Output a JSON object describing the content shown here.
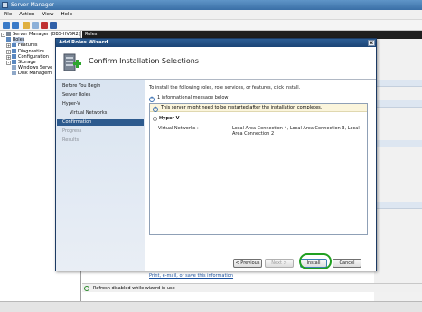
{
  "server_manager": {
    "title": "Server Manager",
    "menu": [
      "File",
      "Action",
      "View",
      "Help"
    ],
    "tree": [
      {
        "label": "Server Manager (OBS-HV5R2)",
        "indent": 0,
        "selected": false,
        "expander": "-"
      },
      {
        "label": "Roles",
        "indent": 1,
        "selected": true,
        "expander": ""
      },
      {
        "label": "Features",
        "indent": 1,
        "selected": false,
        "expander": "+"
      },
      {
        "label": "Diagnostics",
        "indent": 1,
        "selected": false,
        "expander": "+"
      },
      {
        "label": "Configuration",
        "indent": 1,
        "selected": false,
        "expander": "+"
      },
      {
        "label": "Storage",
        "indent": 1,
        "selected": false,
        "expander": "-"
      },
      {
        "label": "Windows Serve",
        "indent": 2,
        "selected": false,
        "expander": ""
      },
      {
        "label": "Disk Managem",
        "indent": 2,
        "selected": false,
        "expander": ""
      }
    ],
    "content_header": "Roles",
    "status_text": "Refresh disabled while wizard in use"
  },
  "wizard": {
    "title": "Add Roles Wizard",
    "close_glyph": "x",
    "heading": "Confirm Installation Selections",
    "steps": [
      {
        "label": "Before You Begin",
        "state": "done",
        "sub": false
      },
      {
        "label": "Server Roles",
        "state": "done",
        "sub": false
      },
      {
        "label": "Hyper-V",
        "state": "done",
        "sub": false
      },
      {
        "label": "Virtual Networks",
        "state": "done",
        "sub": true
      },
      {
        "label": "Confirmation",
        "state": "current",
        "sub": false
      },
      {
        "label": "Progress",
        "state": "disabled",
        "sub": false
      },
      {
        "label": "Results",
        "state": "disabled",
        "sub": false
      }
    ],
    "intro": "To install the following roles, role services, or features, click Install.",
    "info_message": "1 informational message below",
    "warning": "This server might need to be restarted after the installation completes.",
    "role_heading": "Hyper-V",
    "virtual_networks_label": "Virtual Networks :",
    "virtual_networks_value": "Local Area Connection 4, Local Area Connection 3, Local Area Connection 2",
    "print_link": "Print, e-mail, or save this information",
    "buttons": {
      "previous": "< Previous",
      "next": "Next >",
      "install": "Install",
      "cancel": "Cancel"
    },
    "colors": {
      "current_step_bg": "#2d5a8e",
      "highlight_ring": "#21a021",
      "link": "#1a4f9c"
    }
  }
}
